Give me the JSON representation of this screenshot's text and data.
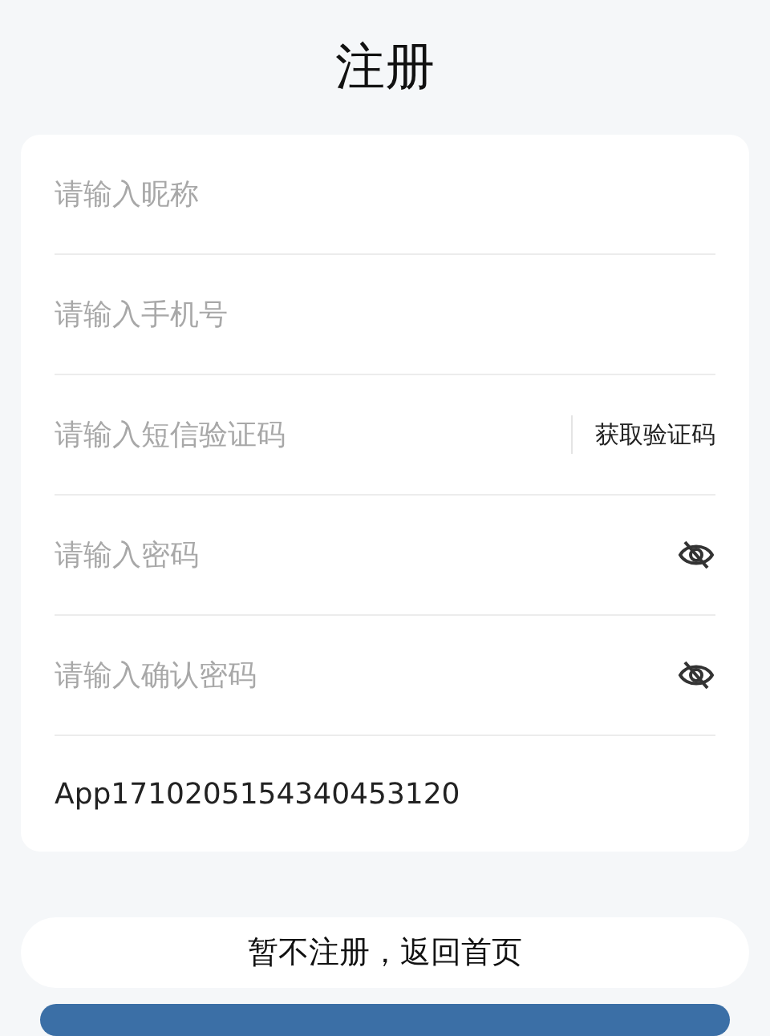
{
  "title": "注册",
  "fields": [
    {
      "kind": "text",
      "placeholder": "请输入昵称"
    },
    {
      "kind": "text",
      "placeholder": "请输入手机号"
    },
    {
      "kind": "code",
      "placeholder": "请输入短信验证码",
      "action": "获取验证码"
    },
    {
      "kind": "password",
      "placeholder": "请输入密码",
      "visible": false
    },
    {
      "kind": "password",
      "placeholder": "请输入确认密码",
      "visible": false
    }
  ],
  "app_id": "App1710205154340453120",
  "buttons": [
    "暂不注册，返回首页"
  ]
}
